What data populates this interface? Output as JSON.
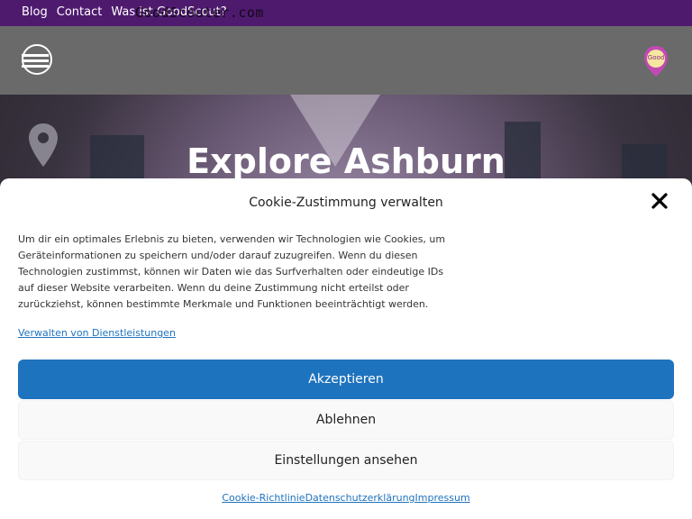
{
  "topbar": {
    "links": [
      "Blog",
      "Contact",
      "Was ist GoodScout?"
    ],
    "ghost_text": "GoodScouter.com"
  },
  "header": {
    "menu_icon": "hamburger-menu-icon",
    "logo_text": "Good"
  },
  "hero": {
    "title": "Explore Ashburn"
  },
  "cookie_modal": {
    "title": "Cookie-Zustimmung verwalten",
    "description": "Um dir ein optimales Erlebnis zu bieten, verwenden wir Technologien wie Cookies, um Geräteinformationen zu speichern und/oder darauf zuzugreifen. Wenn du diesen Technologien zustimmst, können wir Daten wie das Surfverhalten oder eindeutige IDs auf dieser Website verarbeiten. Wenn du deine Zustimmung nicht erteilst oder zurückziehst, können bestimmte Merkmale und Funktionen beeinträchtigt werden.",
    "manage_link": "Verwalten von Dienstleistungen",
    "accept_label": "Akzeptieren",
    "deny_label": "Ablehnen",
    "preferences_label": "Einstellungen ansehen",
    "footer_links": [
      "Cookie-Richtlinie",
      "Datenschutzerklärung",
      "Impressum"
    ],
    "accent_color": "#1e73be"
  }
}
